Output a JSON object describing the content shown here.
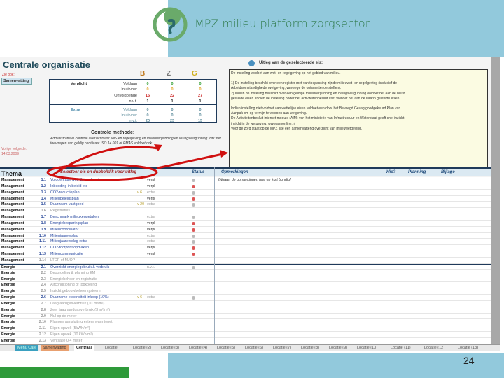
{
  "slide": {
    "title": "MPZ milieu platform zorgsector",
    "page_number": "24"
  },
  "sheet": {
    "title": "Centrale organisatie",
    "zie_ook": "Zie ook:",
    "samenvatting_btn": "Samenvatting",
    "columns": [
      "B",
      "Z",
      "G"
    ],
    "column_colors": [
      "#c07a20",
      "#777777",
      "#d0b020"
    ],
    "score": {
      "verplicht_label": "Verplicht",
      "extra_label": "Extra",
      "rows": [
        {
          "label": "Voldaan",
          "values": [
            "0",
            "0",
            "0"
          ],
          "color": "#2a9a2a"
        },
        {
          "label": "In uitvoer",
          "values": [
            "0",
            "0",
            "0"
          ],
          "color": "#e0a020"
        },
        {
          "label": "Onvoldoende",
          "values": [
            "15",
            "22",
            "27"
          ],
          "color": "#cc2020"
        },
        {
          "label": "n.v.t.",
          "values": [
            "1",
            "1",
            "1"
          ],
          "color": "#111111"
        },
        {
          "label": "Voldaan",
          "values": [
            "0",
            "0",
            "0"
          ],
          "color": "#5a8a9a"
        },
        {
          "label": "In uitvoer",
          "values": [
            "0",
            "0",
            "0"
          ],
          "color": "#5a8a9a"
        },
        {
          "label": "n.v.t.",
          "values": [
            "20",
            "23",
            "15"
          ],
          "color": "#5a8a9a"
        }
      ]
    },
    "controle_title": "Controle methode:",
    "controle_text": "Administratieve controle overzichtslijst wet- en regelgeving en milieuvergunning en lozingsvergunning. NB: het toevoegen van geldig certificaat ISO 14.001 of EMAS voldoet ook",
    "vorig_label": "Vorige volgorde:",
    "vorig_date": "14.03.2009",
    "uitleg_title": "Uitleg van de geselecteerde eis:",
    "uitleg_lines": [
      "De instelling voldoet aan wet- en regelgeving op het gebied van milieu.",
      "",
      "1) De instelling beschikt over een register met van toepassing zijnde milieuwet- en regelgeving (inclusief de",
      "Arbeidsomstandighedenwetgeving, vanwege de ontsmettende stoffen).",
      "2) Indien de instelling beschikt over een geldige milieuvergunning en lozingsvergunning voldoet het aan de hierin",
      "gestelde eisen. Indien de instelling onder het activiteitenbesluit valt, voldoet het aan de daarin gestelde eisen.",
      "",
      "Indien instelling niet voldoet aan wettelijke eisen voldoet een door het Bevoegd Gezag goedgekeurd Plan van",
      "Aanpak om op termijn te voldoen aan wetgeving.",
      "De Activiteitenbesluit internet module (AIM) van het ministerie van Infrastructuur en Waterstaat geeft snel inzicht",
      "inzicht in de wetgeving: www.aimonline.nl",
      "Voor de zorg staat op de MPZ site een samenvattend overzicht van milieuwetgeving."
    ],
    "header": {
      "thema": "Thema",
      "select_hint": "Selecteer eis en dubbelklik voor uitleg",
      "status": "Status",
      "opmerkingen": "Opmerkingen",
      "wie": "Wie?",
      "planning": "Planning",
      "bijlage": "Bijlage"
    },
    "rows": [
      {
        "thema": "Management",
        "no": "1.1",
        "desc": "Voldoen aan wet- & regelgeving",
        "v": "",
        "type": "verpl",
        "status": "gray",
        "opm": "[Noteer de opmerkingen hier en kort bondig]"
      },
      {
        "thema": "Management",
        "no": "1.2",
        "desc": "Inbedding in beleid etc",
        "v": "",
        "type": "verpl",
        "status": "red",
        "opm": ""
      },
      {
        "thema": "Management",
        "no": "1.3",
        "desc": "CO2-reductieplan",
        "v": "v 6",
        "type": "extra",
        "status": "gray",
        "opm": ""
      },
      {
        "thema": "Management",
        "no": "1.4",
        "desc": "Milieubeleidsplan",
        "v": "",
        "type": "verpl",
        "status": "red",
        "opm": ""
      },
      {
        "thema": "Management",
        "no": "1.5",
        "desc": "Duurzaam vastgoed",
        "v": "v 20",
        "type": "extra",
        "status": "gray",
        "opm": ""
      },
      {
        "thema": "Management",
        "no": "1.6",
        "desc": "Registraties",
        "v": "",
        "type": "",
        "status": "",
        "opm": "",
        "dim": true
      },
      {
        "thema": "Management",
        "no": "1.7",
        "desc": "Benchmark milieukengetallen",
        "v": "",
        "type": "extra",
        "status": "gray",
        "opm": ""
      },
      {
        "thema": "Management",
        "no": "1.8",
        "desc": "Energiebesparingsplan",
        "v": "",
        "type": "verpl",
        "status": "red",
        "opm": ""
      },
      {
        "thema": "Management",
        "no": "1.9",
        "desc": "Milieucoördinator",
        "v": "",
        "type": "verpl",
        "status": "red",
        "opm": ""
      },
      {
        "thema": "Management",
        "no": "1.10",
        "desc": "Milieujaarverslag",
        "v": "",
        "type": "extra",
        "status": "gray",
        "opm": ""
      },
      {
        "thema": "Management",
        "no": "1.11",
        "desc": "Milieujaarverslag extra",
        "v": "",
        "type": "extra",
        "status": "gray",
        "opm": ""
      },
      {
        "thema": "Management",
        "no": "1.12",
        "desc": "CO2-footprint opmaken",
        "v": "",
        "type": "verpl",
        "status": "red",
        "opm": ""
      },
      {
        "thema": "Management",
        "no": "1.13",
        "desc": "Milieucommunicatie",
        "v": "",
        "type": "verpl",
        "status": "red",
        "opm": ""
      },
      {
        "thema": "Management",
        "no": "1.14",
        "desc": "LTOP of MJOP",
        "v": "",
        "type": "",
        "status": "",
        "opm": "",
        "dim": true
      },
      {
        "thema": "Energie",
        "no": "2.1",
        "desc": "Overzicht energiegebruik & verbruik",
        "v": "",
        "type": "n.v.t.",
        "status": "gray",
        "opm": ""
      },
      {
        "thema": "Energie",
        "no": "2.2",
        "desc": "Beoordeling & planning EM",
        "v": "",
        "type": "",
        "status": "",
        "opm": "",
        "dim": true
      },
      {
        "thema": "Energie",
        "no": "2.3",
        "desc": "Energiebeheer en registratie",
        "v": "",
        "type": "",
        "status": "",
        "opm": "",
        "dim": true
      },
      {
        "thema": "Energie",
        "no": "2.4",
        "desc": "Airconditioning of topkoeling",
        "v": "",
        "type": "",
        "status": "",
        "opm": "",
        "dim": true
      },
      {
        "thema": "Energie",
        "no": "2.5",
        "desc": "Inzicht gebouwbeheersysteem",
        "v": "",
        "type": "",
        "status": "",
        "opm": "",
        "dim": true
      },
      {
        "thema": "Energie",
        "no": "2.6",
        "desc": "Duurzame electriciteit inkoop (10%)",
        "v": "v 6",
        "type": "extra",
        "status": "gray",
        "opm": ""
      },
      {
        "thema": "Energie",
        "no": "2.7",
        "desc": "Laag aardgasverbruik (10 m³/m²)",
        "v": "",
        "type": "",
        "status": "",
        "opm": "",
        "dim": true
      },
      {
        "thema": "Energie",
        "no": "2.8",
        "desc": "Zeer laag aardgasverbruik (3 m³/m²)",
        "v": "",
        "type": "",
        "status": "",
        "opm": "",
        "dim": true
      },
      {
        "thema": "Energie",
        "no": "2.9",
        "desc": "Nul op de meter",
        "v": "",
        "type": "",
        "status": "",
        "opm": "",
        "dim": true
      },
      {
        "thema": "Energie",
        "no": "2.10",
        "desc": "Plannen aansluiting extern warmtenet",
        "v": "",
        "type": "",
        "status": "",
        "opm": "",
        "dim": true
      },
      {
        "thema": "Energie",
        "no": "2.11",
        "desc": "Eigen opwek (5kWh/m²)",
        "v": "",
        "type": "",
        "status": "",
        "opm": "",
        "dim": true
      },
      {
        "thema": "Energie",
        "no": "2.12",
        "desc": "Eigen opwek (10 kWh/m²)",
        "v": "",
        "type": "",
        "status": "",
        "opm": "",
        "dim": true
      },
      {
        "thema": "Energie",
        "no": "2.13",
        "desc": "Ventilatie 0.4 meter",
        "v": "",
        "type": "",
        "status": "",
        "opm": "",
        "dim": true
      }
    ],
    "tabs": [
      "Menu Care",
      "Samenvatting",
      "Centraal",
      "Locatie",
      "Locatie (2)",
      "Locatie (3)",
      "Locatie (4)",
      "Locatie (5)",
      "Locatie (6)",
      "Locatie (7)",
      "Locatie (8)",
      "Locatie (9)",
      "Locatie (10)",
      "Locatie (11)",
      "Locatie (12)",
      "Locatie (13)"
    ],
    "active_tab": "Centraal"
  }
}
